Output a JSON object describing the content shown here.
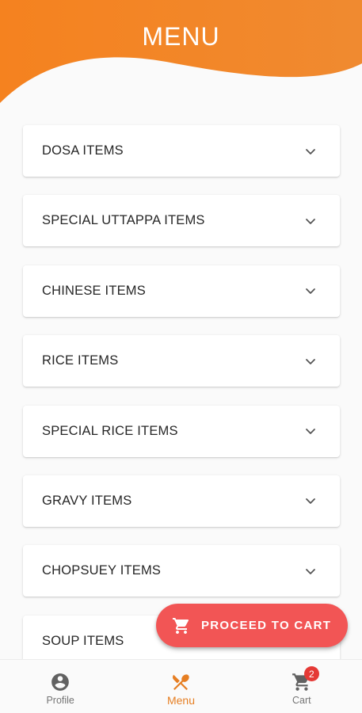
{
  "header": {
    "title": "MENU"
  },
  "menu": {
    "categories": [
      {
        "label": "DOSA ITEMS"
      },
      {
        "label": "SPECIAL UTTAPPA ITEMS"
      },
      {
        "label": "CHINESE ITEMS"
      },
      {
        "label": "RICE ITEMS"
      },
      {
        "label": "SPECIAL RICE ITEMS"
      },
      {
        "label": "GRAVY ITEMS"
      },
      {
        "label": "CHOPSUEY ITEMS"
      },
      {
        "label": "SOUP ITEMS"
      }
    ]
  },
  "fab": {
    "label": "PROCEED TO CART",
    "icon": "cart-icon",
    "color": "#f25555"
  },
  "bottom_nav": {
    "items": [
      {
        "label": "Profile",
        "icon": "account-circle-icon",
        "active": false
      },
      {
        "label": "Menu",
        "icon": "restaurant-icon",
        "active": true
      },
      {
        "label": "Cart",
        "icon": "cart-icon",
        "active": false,
        "badge": "2"
      }
    ]
  },
  "colors": {
    "header_gradient_start": "#f5821f",
    "header_gradient_end": "#f08a30",
    "active_nav": "#e67e22",
    "badge": "#e53935"
  }
}
